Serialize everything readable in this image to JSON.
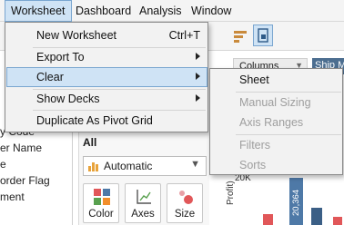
{
  "menubar": {
    "items": [
      {
        "label": "Worksheet",
        "active": true
      },
      {
        "label": "Dashboard",
        "active": false
      },
      {
        "label": "Analysis",
        "active": false
      },
      {
        "label": "Window",
        "active": false
      }
    ]
  },
  "worksheet_menu": {
    "items": [
      {
        "label": "New Worksheet",
        "shortcut": "Ctrl+T",
        "submenu": false
      },
      {
        "label": "Export To",
        "submenu": true
      },
      {
        "label": "Clear",
        "submenu": true,
        "highlighted": true
      },
      {
        "label": "Show Decks",
        "submenu": true
      },
      {
        "label": "Duplicate As Pivot Grid",
        "submenu": false
      }
    ]
  },
  "clear_submenu": {
    "items": [
      {
        "label": "Sheet",
        "enabled": true
      },
      {
        "label": "Manual Sizing",
        "enabled": false
      },
      {
        "label": "Axis Ranges",
        "enabled": false
      },
      {
        "label": "Filters",
        "enabled": false
      },
      {
        "label": "Sorts",
        "enabled": false
      }
    ]
  },
  "data_pane": {
    "fields": [
      "y Code",
      "er Name",
      "e",
      "order Flag",
      "ment"
    ]
  },
  "marks_card": {
    "header": "All",
    "mark_type": "Automatic",
    "buttons": [
      "Color",
      "Axes",
      "Size"
    ]
  },
  "shelves": {
    "columns_label": "Columns",
    "columns_pill": "Ship M"
  },
  "chart": {
    "y_tick": "20K",
    "y_label": "Profit)",
    "bar_label": "20,364",
    "colors": {
      "bar_blue": "#4e79a7",
      "bar_red": "#e15759",
      "bar_dark": "#3b5f86"
    }
  },
  "colors": {
    "menu_highlight": "#cfe3f5",
    "menu_highlight_border": "#7aa6d0",
    "disabled_text": "#9e9e9e"
  }
}
